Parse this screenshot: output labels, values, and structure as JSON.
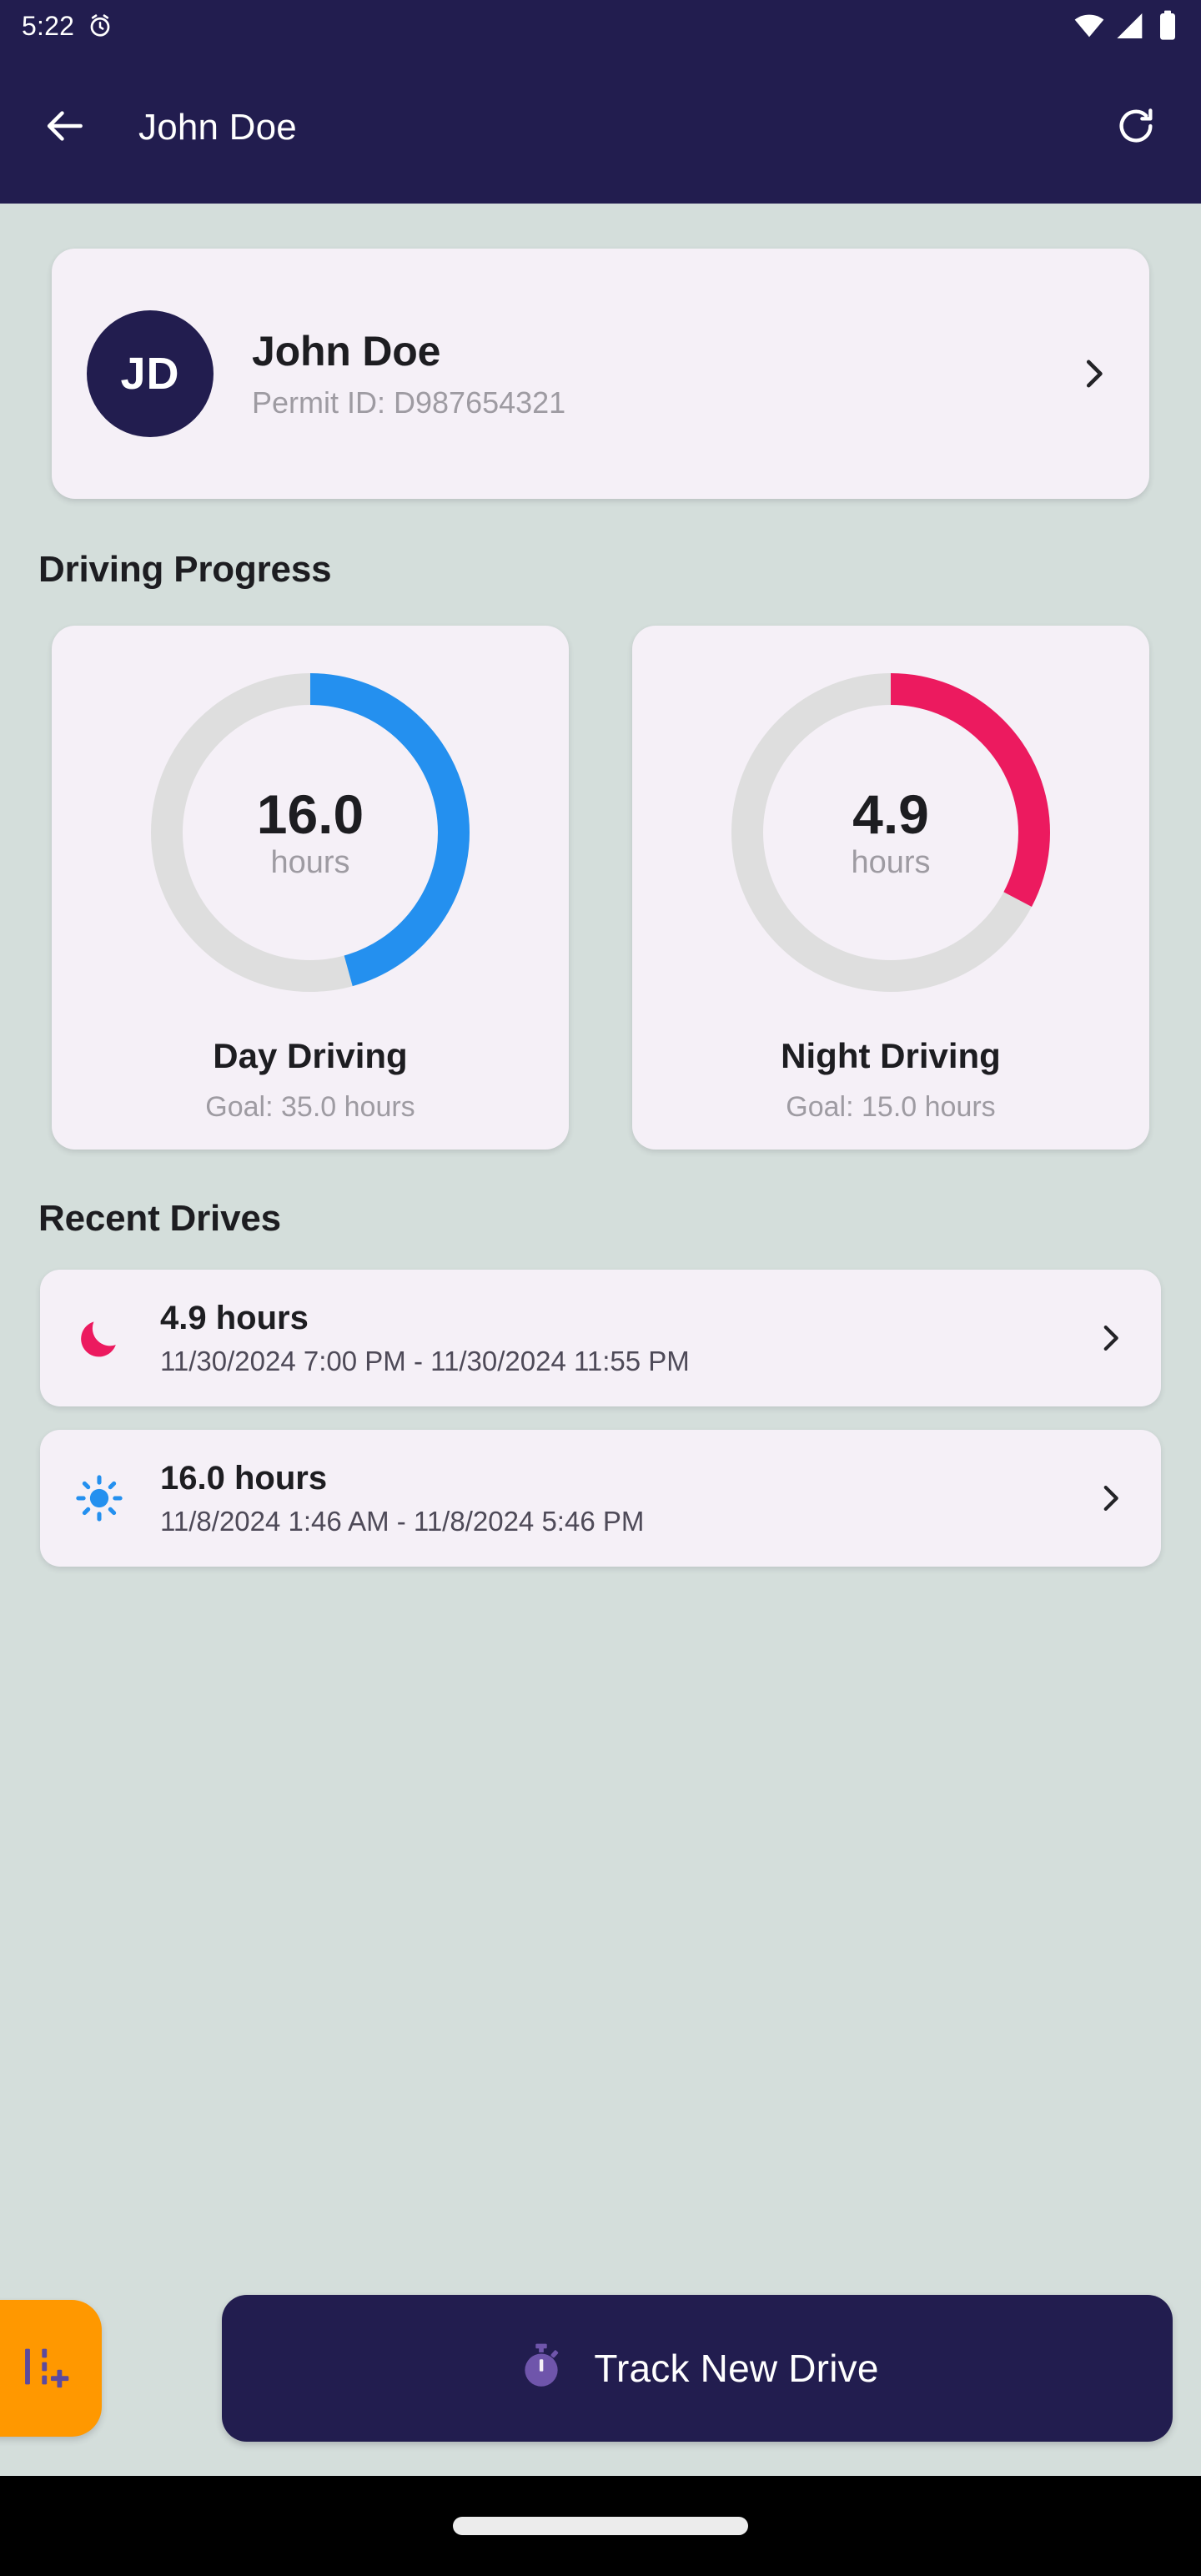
{
  "status_bar": {
    "time": "5:22",
    "left_icon": "alarm-clock-icon",
    "right_icons": [
      "wifi-icon",
      "cellular-signal-icon",
      "battery-icon"
    ]
  },
  "app_bar": {
    "back_icon": "back-arrow-icon",
    "title": "John Doe",
    "refresh_icon": "refresh-icon"
  },
  "profile": {
    "initials": "JD",
    "name": "John Doe",
    "permit": "Permit ID: D987654321",
    "chevron_icon": "chevron-right-icon"
  },
  "sections": {
    "progress_title": "Driving Progress",
    "recent_title": "Recent Drives"
  },
  "progress_cards": [
    {
      "value": "16.0",
      "unit": "hours",
      "label": "Day Driving",
      "goal": "Goal: 35.0 hours",
      "color": "#2490ef",
      "track_color": "#dedede",
      "percent": 45.7
    },
    {
      "value": "4.9",
      "unit": "hours",
      "label": "Night Driving",
      "goal": "Goal: 15.0 hours",
      "color": "#ec1a5f",
      "track_color": "#dedede",
      "percent": 32.7
    }
  ],
  "recent_drives": [
    {
      "icon": "moon-icon",
      "icon_color": "#ec1a5f",
      "hours": "4.9 hours",
      "range": "11/30/2024 7:00 PM - 11/30/2024 11:55 PM",
      "chevron_icon": "chevron-right-icon"
    },
    {
      "icon": "sun-icon",
      "icon_color": "#2490ef",
      "hours": "16.0 hours",
      "range": "11/8/2024 1:46 AM - 11/8/2024 5:46 PM",
      "chevron_icon": "chevron-right-icon"
    }
  ],
  "bottom_actions": {
    "fab_icon": "add-road-icon",
    "fab_color": "#ff9800",
    "track_icon": "stopwatch-icon",
    "track_label": "Track New Drive",
    "track_color": "#221d4f"
  },
  "theme": {
    "background": "#d4dedb",
    "surface": "#f5f0f7",
    "primary": "#221d4f",
    "text": "#1d1d21",
    "muted": "#9e9ba2"
  }
}
